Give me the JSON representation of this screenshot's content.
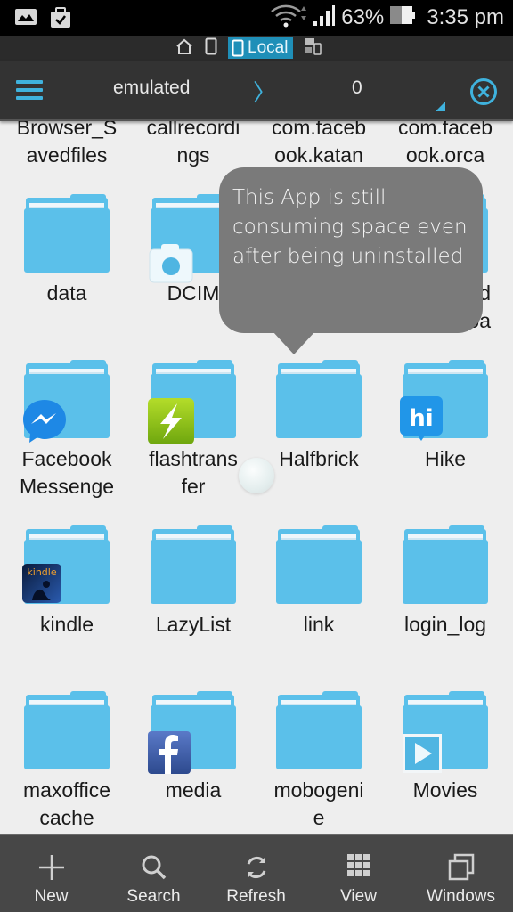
{
  "status_bar": {
    "battery_percent": "63%",
    "time": "3:35 pm",
    "icons": [
      "gallery-icon",
      "task-check-icon",
      "wifi-icon",
      "signal-icon",
      "battery-icon"
    ]
  },
  "location_bar": {
    "items": [
      "home-icon",
      "phone-icon",
      "local-tab",
      "network-icon"
    ],
    "local_label": "Local"
  },
  "toolbar": {
    "menu_icon": "hamburger-icon",
    "path_segments": [
      "emulated",
      "0"
    ],
    "separator": "〉",
    "close_icon": "close-circle-icon",
    "accent_color": "#3fb2dd"
  },
  "folders": [
    {
      "name": "Browser_S\navedfiles",
      "badge": null,
      "partial": true
    },
    {
      "name": "callrecordi\nngs",
      "badge": null,
      "partial": true
    },
    {
      "name": "com.faceb\nook.katan",
      "badge": null,
      "partial": true
    },
    {
      "name": "com.faceb\nook.orca",
      "badge": null,
      "partial": true
    },
    {
      "name": "data",
      "badge": null
    },
    {
      "name": "DCIM",
      "badge": "camera-icon"
    },
    {
      "name": "",
      "badge": null,
      "hidden_by_bubble": true
    },
    {
      "name": "d\nploa",
      "badge": null,
      "partially_hidden": true
    },
    {
      "name": "Facebook\nMessenge",
      "badge": "messenger-icon"
    },
    {
      "name": "flashtrans\nfer",
      "badge": "flash-transfer-icon"
    },
    {
      "name": "Halfbrick",
      "badge": null
    },
    {
      "name": "Hike",
      "badge": "hike-icon"
    },
    {
      "name": "kindle",
      "badge": "kindle-icon"
    },
    {
      "name": "LazyList",
      "badge": null
    },
    {
      "name": "link",
      "badge": null
    },
    {
      "name": "login_log",
      "badge": null
    },
    {
      "name": "maxoffice\ncache",
      "badge": null
    },
    {
      "name": "media",
      "badge": "facebook-icon"
    },
    {
      "name": "mobogeni\ne",
      "badge": null
    },
    {
      "name": "Movies",
      "badge": "play-icon"
    }
  ],
  "annotation": {
    "text": "This App is still consuming space even after being uninstalled"
  },
  "bottom_bar": [
    {
      "label": "New",
      "icon": "plus-icon"
    },
    {
      "label": "Search",
      "icon": "search-icon"
    },
    {
      "label": "Refresh",
      "icon": "refresh-icon"
    },
    {
      "label": "View",
      "icon": "grid-view-icon"
    },
    {
      "label": "Windows",
      "icon": "windows-icon"
    }
  ],
  "colors": {
    "folder": "#5bc0ea",
    "accent": "#3fb2dd",
    "toolbar_bg": "#333333",
    "bottom_bar_bg": "#474747",
    "bubble_bg": "#7a7a7a"
  }
}
